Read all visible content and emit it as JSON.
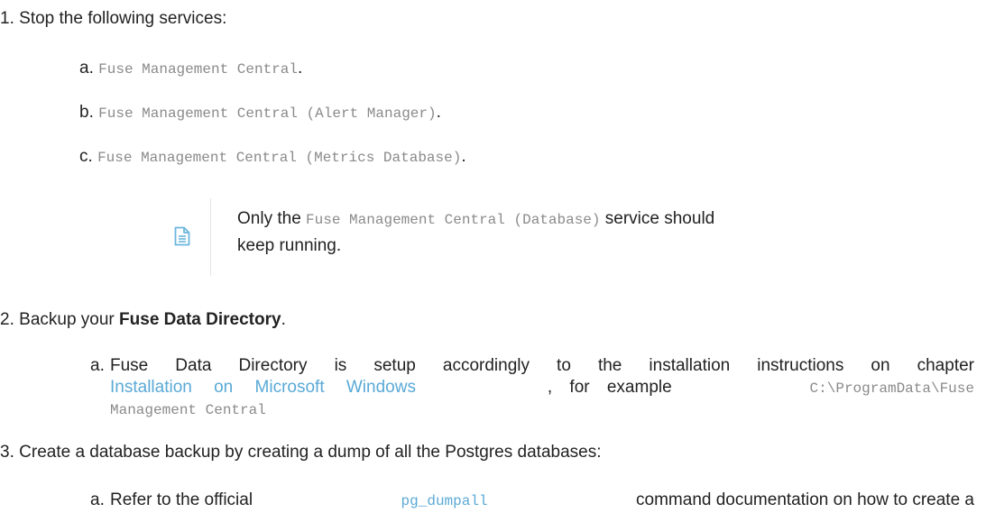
{
  "steps": [
    {
      "num": "1.",
      "text": "Stop the following services:",
      "subs": [
        {
          "letter": "a.",
          "code": "Fuse Management Central",
          "tail": "."
        },
        {
          "letter": "b.",
          "code": "Fuse Management Central (Alert Manager)",
          "tail": "."
        },
        {
          "letter": "c.",
          "code": "Fuse Management Central (Metrics Database)",
          "tail": "."
        }
      ],
      "note": {
        "icon": "note-icon",
        "pre": "Only the",
        "code": "Fuse Management Central (Database)",
        "post": "service should",
        "line2": "keep running."
      }
    },
    {
      "num": "2.",
      "text_pre": "Backup your",
      "bold": "Fuse Data Directory",
      "text_post": ".",
      "sub": {
        "letter": "a.",
        "line1": "Fuse Data Directory is setup accordingly to the installation instructions on chapter",
        "link": "Installation on Microsoft Windows",
        "mid": ", for example",
        "code1": "C:\\ProgramData\\Fuse",
        "code2": "Management Central"
      }
    },
    {
      "num": "3.",
      "text": "Create a database backup by creating a dump of all the Postgres databases:",
      "sub": {
        "letter": "a.",
        "pre": "Refer to the official",
        "code": "pg_dumpall",
        "post": "command documentation on how to create a"
      }
    }
  ]
}
